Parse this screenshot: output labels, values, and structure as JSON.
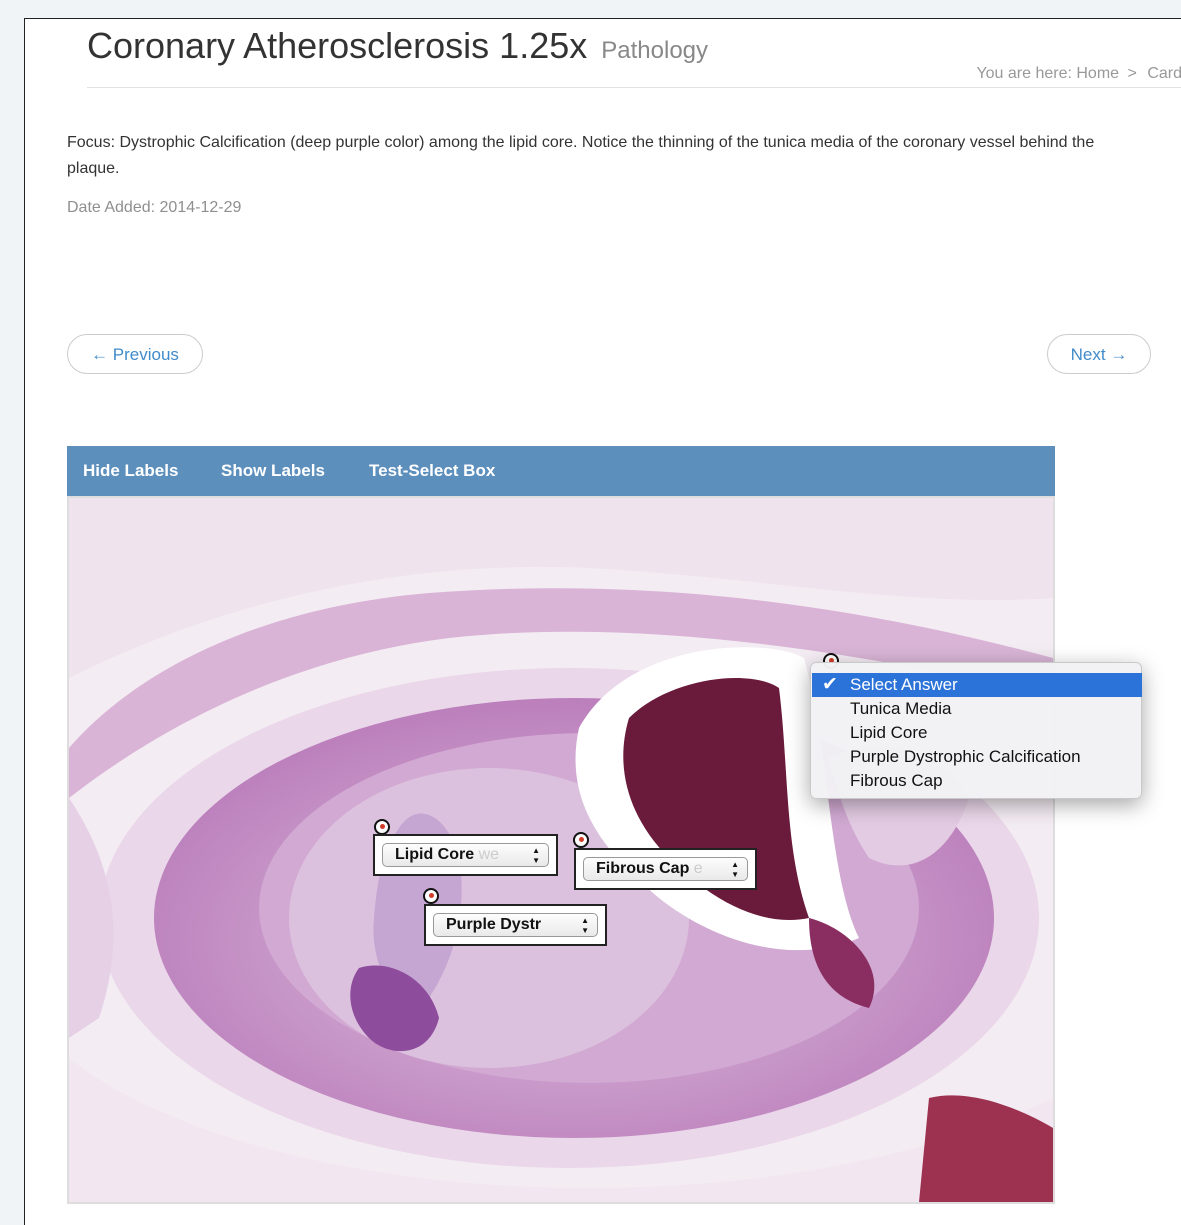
{
  "header": {
    "title": "Coronary Atherosclerosis 1.25x",
    "category": "Pathology",
    "breadcrumb": {
      "prefix": "You are here:",
      "home": "Home",
      "separator": ">",
      "current": "Card"
    }
  },
  "content": {
    "description": "Focus: Dystrophic Calcification (deep purple color) among the lipid core. Notice the thinning of the tunica media of the coronary vessel behind the plaque.",
    "date_added": "Date Added: 2014-12-29"
  },
  "pager": {
    "previous": "← Previous",
    "next": "Next →"
  },
  "toolbar": {
    "hide_labels": "Hide Labels",
    "show_labels": "Show Labels",
    "test_select": "Test-Select Box"
  },
  "labels": [
    {
      "text": "Lipid Core",
      "overflow": "we"
    },
    {
      "text": "Fibrous Cap",
      "overflow": "e"
    },
    {
      "text": "Purple Dystr",
      "overflow": ""
    }
  ],
  "dropdown": {
    "selected": "Select Answer",
    "options": [
      "Select Answer",
      "Tunica Media",
      "Lipid Core",
      "Purple Dystrophic Calcification",
      "Fibrous Cap"
    ]
  },
  "colors": {
    "toolbar": "#5d8fbd",
    "link": "#428bca",
    "selection": "#2b73d8",
    "tissue_pink": "#c98bc4",
    "lumen_dark": "#6a1a3a"
  }
}
